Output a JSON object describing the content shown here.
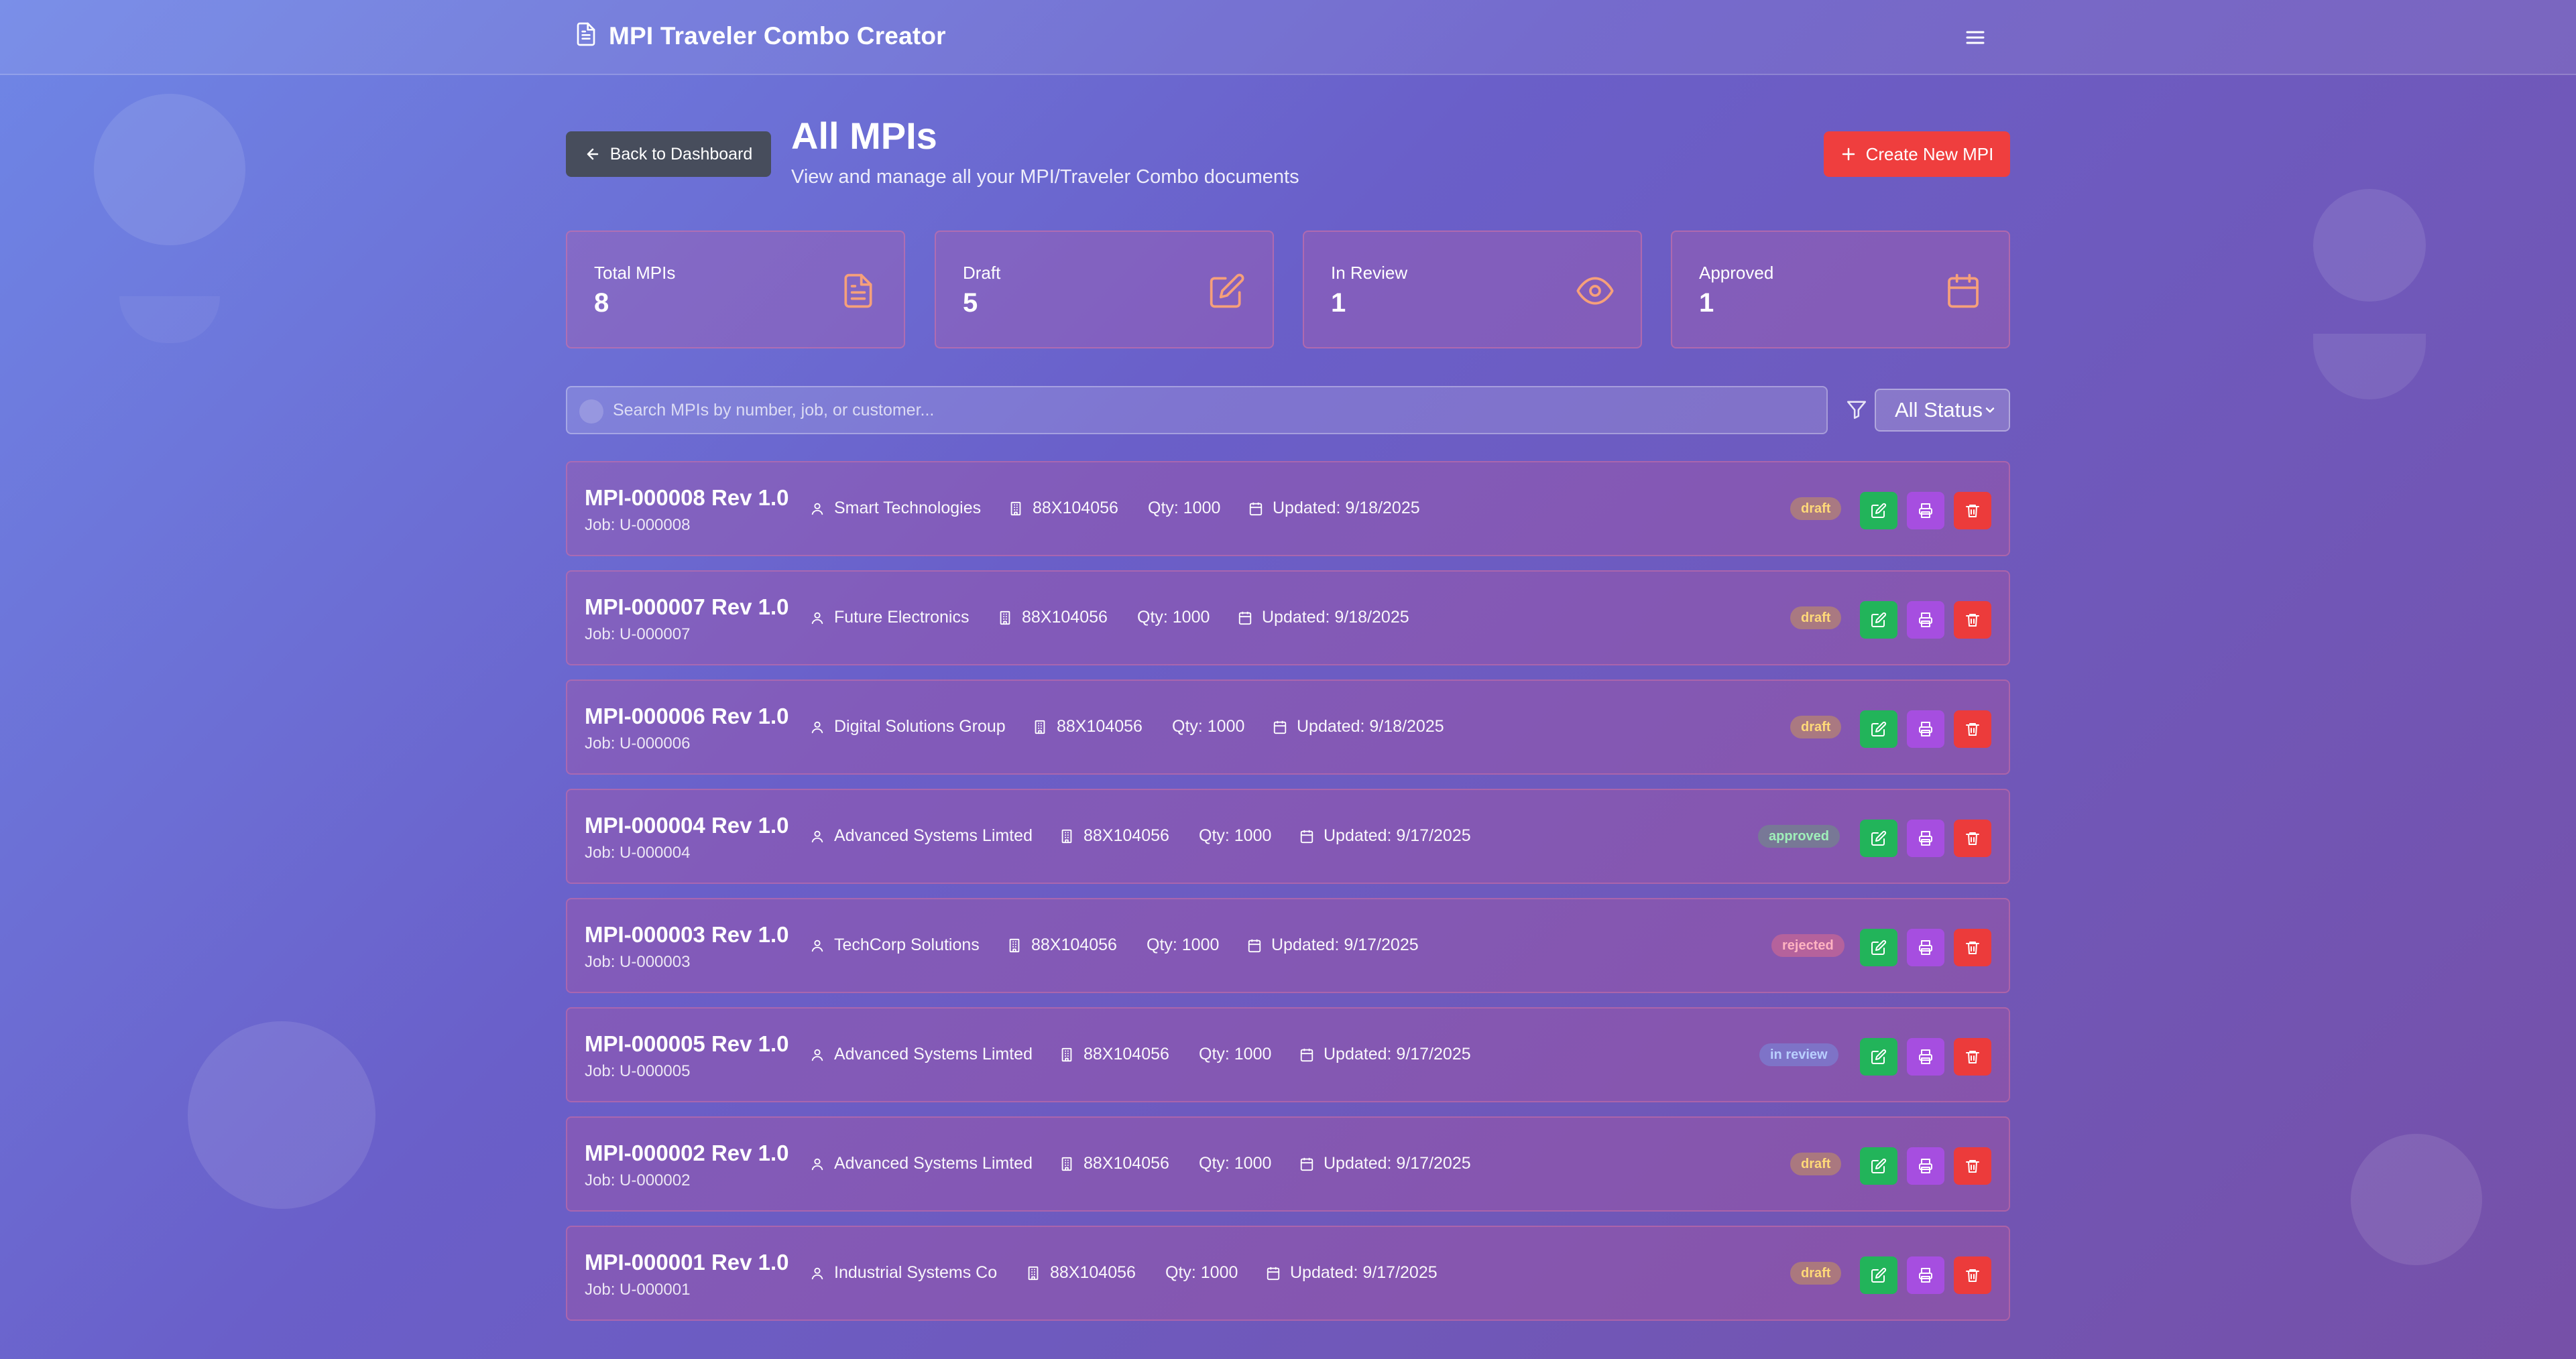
{
  "app": {
    "title": "MPI Traveler Combo Creator"
  },
  "page": {
    "back_label": "Back to Dashboard",
    "title": "All MPIs",
    "subtitle": "View and manage all your MPI/Traveler Combo documents",
    "create_label": "Create New MPI"
  },
  "stats": [
    {
      "label": "Total MPIs",
      "value": "8",
      "icon": "document-icon"
    },
    {
      "label": "Draft",
      "value": "5",
      "icon": "edit-icon"
    },
    {
      "label": "In Review",
      "value": "1",
      "icon": "eye-icon"
    },
    {
      "label": "Approved",
      "value": "1",
      "icon": "calendar-icon"
    }
  ],
  "search": {
    "placeholder": "Search MPIs by number, job, or customer...",
    "value": ""
  },
  "filter": {
    "selected": "All Status"
  },
  "colors": {
    "accent_red": "#ef3e3e",
    "edit_green": "#22b45a",
    "print_purple": "#a64ee0",
    "delete_red": "#ec3b3b"
  },
  "mpis": [
    {
      "title": "MPI-000008 Rev 1.0",
      "job": "Job: U-000008",
      "customer": "Smart Technologies",
      "part": "88X104056",
      "qty": "Qty: 1000",
      "updated": "Updated: 9/18/2025",
      "status": "draft"
    },
    {
      "title": "MPI-000007 Rev 1.0",
      "job": "Job: U-000007",
      "customer": "Future Electronics",
      "part": "88X104056",
      "qty": "Qty: 1000",
      "updated": "Updated: 9/18/2025",
      "status": "draft"
    },
    {
      "title": "MPI-000006 Rev 1.0",
      "job": "Job: U-000006",
      "customer": "Digital Solutions Group",
      "part": "88X104056",
      "qty": "Qty: 1000",
      "updated": "Updated: 9/18/2025",
      "status": "draft"
    },
    {
      "title": "MPI-000004 Rev 1.0",
      "job": "Job: U-000004",
      "customer": "Advanced Systems Limted",
      "part": "88X104056",
      "qty": "Qty: 1000",
      "updated": "Updated: 9/17/2025",
      "status": "approved"
    },
    {
      "title": "MPI-000003 Rev 1.0",
      "job": "Job: U-000003",
      "customer": "TechCorp Solutions",
      "part": "88X104056",
      "qty": "Qty: 1000",
      "updated": "Updated: 9/17/2025",
      "status": "rejected"
    },
    {
      "title": "MPI-000005 Rev 1.0",
      "job": "Job: U-000005",
      "customer": "Advanced Systems Limted",
      "part": "88X104056",
      "qty": "Qty: 1000",
      "updated": "Updated: 9/17/2025",
      "status": "in review"
    },
    {
      "title": "MPI-000002 Rev 1.0",
      "job": "Job: U-000002",
      "customer": "Advanced Systems Limted",
      "part": "88X104056",
      "qty": "Qty: 1000",
      "updated": "Updated: 9/17/2025",
      "status": "draft"
    },
    {
      "title": "MPI-000001 Rev 1.0",
      "job": "Job: U-000001",
      "customer": "Industrial Systems Co",
      "part": "88X104056",
      "qty": "Qty: 1000",
      "updated": "Updated: 9/17/2025",
      "status": "draft"
    }
  ]
}
